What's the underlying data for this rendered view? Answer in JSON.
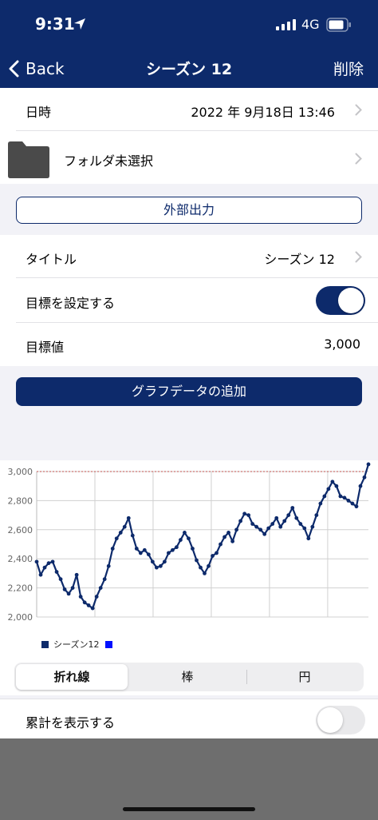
{
  "status_bar": {
    "time": "9:31",
    "network": "4G"
  },
  "nav": {
    "back_label": "Back",
    "title": "シーズン 12",
    "delete_label": "削除"
  },
  "date_row": {
    "label": "日時",
    "value": "2022 年 9月18日 13:46"
  },
  "folder_row": {
    "label": "フォルダ未選択"
  },
  "export_button": "外部出力",
  "title_row": {
    "label": "タイトル",
    "value": "シーズン 12"
  },
  "goal_toggle_row": {
    "label": "目標を設定する",
    "on": true
  },
  "goal_value_row": {
    "label": "目標値",
    "value": "3,000"
  },
  "add_data_button": "グラフデータの追加",
  "segments": [
    "折れ線",
    "棒",
    "円"
  ],
  "selected_segment": "折れ線",
  "cumulative_row": {
    "label": "累計を表示する",
    "on": false
  },
  "colors": {
    "navy": "#0d2a6b",
    "goal_line": "#c0504d"
  },
  "chart_data": {
    "type": "line",
    "ylim": [
      2000,
      3000
    ],
    "yticks": [
      "3,000",
      "2,800",
      "2,600",
      "2,400",
      "2,200",
      "2,000"
    ],
    "goal": 3000,
    "legend": [
      "シーズン12"
    ],
    "series": [
      {
        "name": "シーズン12",
        "values": [
          2380,
          2290,
          2340,
          2370,
          2380,
          2310,
          2260,
          2190,
          2160,
          2200,
          2290,
          2140,
          2100,
          2080,
          2060,
          2140,
          2200,
          2260,
          2350,
          2470,
          2540,
          2580,
          2620,
          2680,
          2560,
          2470,
          2440,
          2460,
          2430,
          2380,
          2340,
          2350,
          2380,
          2440,
          2460,
          2480,
          2530,
          2580,
          2540,
          2470,
          2390,
          2340,
          2300,
          2350,
          2420,
          2440,
          2500,
          2550,
          2580,
          2520,
          2600,
          2660,
          2710,
          2700,
          2640,
          2620,
          2600,
          2570,
          2610,
          2640,
          2680,
          2620,
          2660,
          2700,
          2750,
          2680,
          2640,
          2610,
          2540,
          2620,
          2700,
          2780,
          2830,
          2880,
          2930,
          2900,
          2830,
          2820,
          2800,
          2780,
          2760,
          2900,
          2960,
          3050
        ]
      }
    ]
  }
}
